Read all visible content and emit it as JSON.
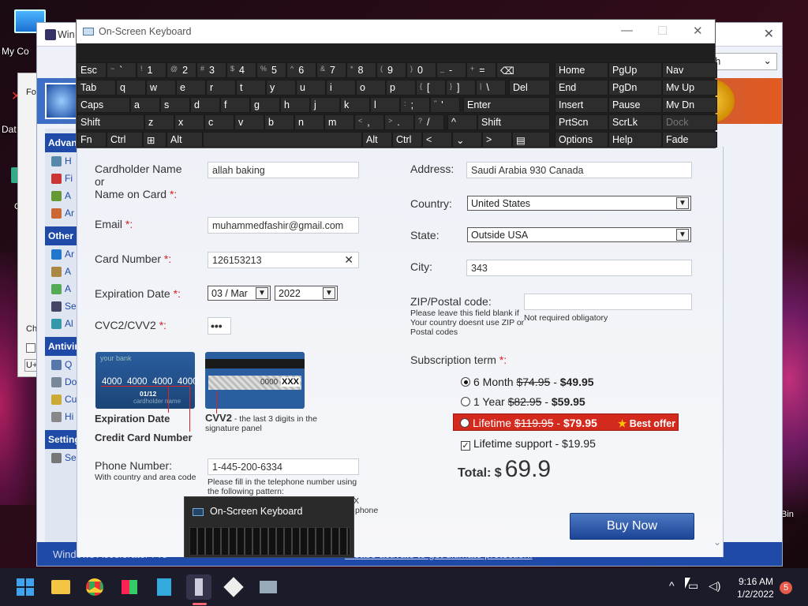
{
  "desktop": {
    "icons": [
      {
        "label": "My Co",
        "name": "my-computer-icon"
      },
      {
        "label": "Fo",
        "name": "folder-icon"
      },
      {
        "label": "Dat",
        "name": "data-icon"
      },
      {
        "label": "C",
        "name": "c-icon"
      },
      {
        "label": "Ch",
        "name": "ch-icon"
      },
      {
        "label": "U+",
        "name": "u-icon"
      },
      {
        "label": "Bin",
        "name": "recycle-bin-icon"
      }
    ]
  },
  "back_window": {
    "title": "Win",
    "combo_value": "sh",
    "sections": [
      {
        "title": "Advan",
        "items": [
          "H",
          "Fi",
          "A",
          "Ar"
        ]
      },
      {
        "title": "Other s",
        "items": [
          "Ar",
          "A",
          "A",
          "Se",
          "Al"
        ]
      },
      {
        "title": "Antivir",
        "items": [
          "Q",
          "Do",
          "Cu",
          "Hi"
        ]
      },
      {
        "title": "Setting",
        "items": [
          "Se"
        ]
      }
    ],
    "status_left": "Windows Accelerator Pro",
    "status_link": "Please activate to get ultimate protection."
  },
  "osk": {
    "title": "On-Screen Keyboard",
    "rows": [
      [
        {
          "s": "~",
          "m": "`"
        },
        {
          "s": "!",
          "m": "1"
        },
        {
          "s": "@",
          "m": "2"
        },
        {
          "s": "#",
          "m": "3"
        },
        {
          "s": "$",
          "m": "4"
        },
        {
          "s": "%",
          "m": "5"
        },
        {
          "s": "^",
          "m": "6"
        },
        {
          "s": "&",
          "m": "7"
        },
        {
          "s": "*",
          "m": "8"
        },
        {
          "s": "(",
          "m": "9"
        },
        {
          "s": ")",
          "m": "0"
        },
        {
          "s": "_",
          "m": "-"
        },
        {
          "s": "+",
          "m": "="
        }
      ],
      [
        "q",
        "w",
        "e",
        "r",
        "t",
        "y",
        "u",
        "i",
        "o",
        "p"
      ],
      [
        "a",
        "s",
        "d",
        "f",
        "g",
        "h",
        "j",
        "k",
        "l"
      ],
      [
        "z",
        "x",
        "c",
        "v",
        "b",
        "n",
        "m"
      ]
    ],
    "bracket_keys": [
      {
        "s": "{",
        "m": "["
      },
      {
        "s": "}",
        "m": "]"
      },
      {
        "s": "|",
        "m": "\\"
      }
    ],
    "semi_keys": [
      {
        "s": ":",
        "m": ";"
      },
      {
        "s": "\"",
        "m": "'"
      }
    ],
    "comma_keys": [
      {
        "s": "<",
        "m": ","
      },
      {
        "s": ">",
        "m": "."
      },
      {
        "s": "?",
        "m": "/"
      }
    ],
    "labels": {
      "esc": "Esc",
      "tab": "Tab",
      "caps": "Caps",
      "shift": "Shift",
      "fn": "Fn",
      "ctrl": "Ctrl",
      "alt": "Alt",
      "del": "Del",
      "enter": "Enter",
      "backspace": "⌫",
      "up": "^",
      "down": "⌄",
      "left": "<",
      "right": ">",
      "menu": "▤",
      "win": "⊞"
    },
    "nav_keys": [
      [
        "Home",
        "PgUp",
        "Nav"
      ],
      [
        "End",
        "PgDn",
        "Mv Up"
      ],
      [
        "Insert",
        "Pause",
        "Mv Dn"
      ],
      [
        "PrtScn",
        "ScrLk",
        "Dock"
      ],
      [
        "Options",
        "Help",
        "Fade"
      ]
    ],
    "preview_title": "On-Screen Keyboard"
  },
  "form": {
    "cardholder_label": "Cardholder Name\nor\nName on Card",
    "cardholder_value": "allah baking",
    "email_label": "Email",
    "email_value": "muhammedfashir@gmail.com",
    "card_number_label": "Card Number",
    "card_number_value": "126153213",
    "expiration_label": "Expiration Date",
    "exp_month": "03 / Mar",
    "exp_year": "2022",
    "cvc_label": "CVC2/CVV2",
    "cvc_value": "•••",
    "req_mark": "*:",
    "card_front_name": "your bank",
    "card_front_number": "4000  4000  4000  4000",
    "card_front_exp": "01/12",
    "card_front_holder": "cardholder name",
    "card_back_code": "0000",
    "card_back_xxx": "XXX",
    "exp_caption": "Expiration Date",
    "ccn_caption": "Credit Card Number",
    "cvv_caption_bold": "CVV2",
    "cvv_caption": " - the last 3 digits in the signature panel",
    "phone_label": "Phone Number:",
    "phone_sub": "With country and area code",
    "phone_value": "1-445-200-6334",
    "phone_hint": "Please fill in the telephone number using the following pattern:",
    "phone_hint_tail1": "X",
    "phone_hint_tail2": "phone",
    "address_label": "Address:",
    "address_value": "Saudi Arabia 930 Canada",
    "country_label": "Country:",
    "country_value": "United States",
    "state_label": "State:",
    "state_value": "Outside USA",
    "city_label": "City:",
    "city_value": "343",
    "zip_label": "ZIP/Postal code:",
    "zip_hint": "Please leave this field blank if Your country doesnt use ZIP or Postal codes",
    "zip_note": "Not required obligatory",
    "sub_label": "Subscription term",
    "options": [
      {
        "label": "6 Month ",
        "old": "$74.95",
        "sep": " - ",
        "price": "$49.95",
        "selected": true
      },
      {
        "label": "1 Year ",
        "old": "$82.95",
        "sep": " - ",
        "price": "$59.95",
        "selected": false
      },
      {
        "label": "Lifetime ",
        "old": "$119.95",
        "sep": " - ",
        "price": "$79.95",
        "selected": false,
        "badge": "Best offer"
      }
    ],
    "support_label": "Lifetime support - $19.95",
    "total_label": "Total: $",
    "total_value": "69.9",
    "buy_label": "Buy Now"
  },
  "taskbar": {
    "time": "9:16 AM",
    "date": "1/2/2022",
    "notif_count": "5"
  },
  "colors": {
    "accent": "#1f4aa8",
    "lifetime_bg": "#d42a1e",
    "buy": "#2a59a8"
  }
}
